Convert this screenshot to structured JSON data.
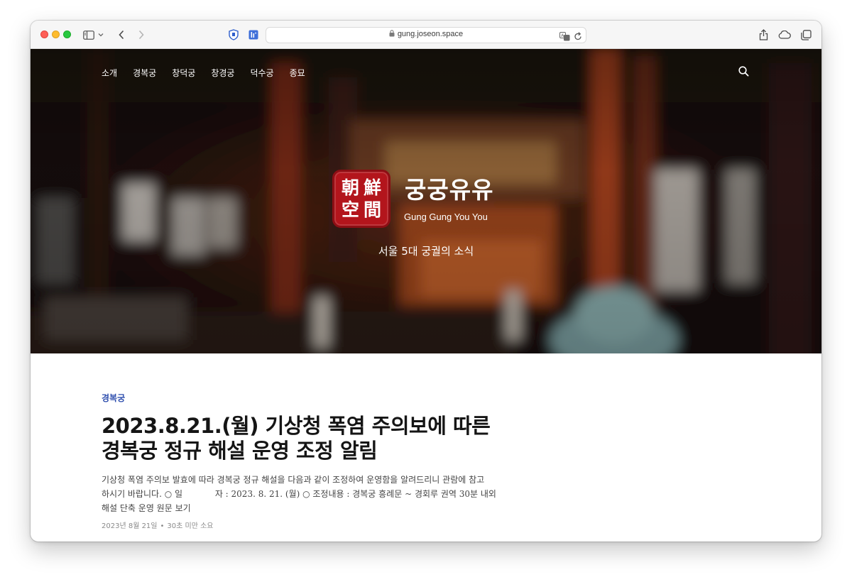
{
  "browser": {
    "url": "gung.joseon.space",
    "icons": [
      "sidebar-icon",
      "chevron-down-icon",
      "back-icon",
      "forward-icon",
      "privacy-shield-icon",
      "extension-icon",
      "lock-icon",
      "translate-icon",
      "reload-icon",
      "share-icon",
      "cloud-icon",
      "tabs-icon"
    ]
  },
  "nav": {
    "items": [
      "소개",
      "경복궁",
      "창덕궁",
      "창경궁",
      "덕수궁",
      "종묘"
    ]
  },
  "hero": {
    "seal_chars": [
      "朝",
      "鮮",
      "空",
      "間"
    ],
    "site_title": "궁궁유유",
    "site_subtitle": "Gung Gung You You",
    "tagline": "서울 5대 궁궐의 소식"
  },
  "post": {
    "category": "경복궁",
    "title_line1": "2023.8.21.(월) 기상청 폭염 주의보에 따른",
    "title_line2": "경복궁 정규 해설 운영 조정 알림",
    "excerpt_line1": "기상청 폭염 주의보 발효에 따라 경복궁 정규 해설을 다음과 같이 조정하여 운영함을 알려드리니 관람에 참고",
    "excerpt_line2": "하시기 바랍니다. ○ 일            자 : 2023. 8. 21. (월) ○ 조정내용 : 경복궁 흥례문 ~ 경회루 권역 30분 내외",
    "excerpt_line3": "해설 단축 운영 원문 보기",
    "date": "2023년 8월 21일",
    "separator": "•",
    "read_time": "30초 미만 소요"
  }
}
